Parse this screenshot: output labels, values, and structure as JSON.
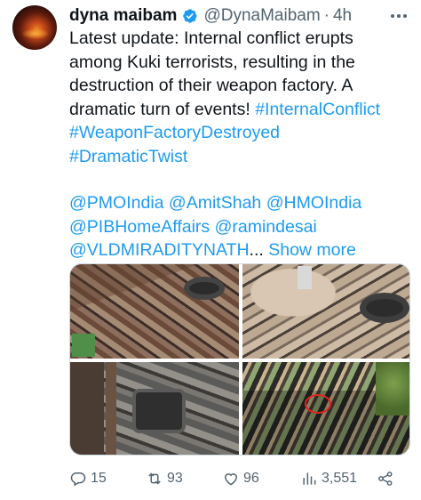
{
  "author": {
    "display_name": "dyna maibam",
    "handle": "@DynaMaibam",
    "separator": "·",
    "time": "4h",
    "verified_icon": "verified-badge-icon"
  },
  "tweet": {
    "lines": [
      "Latest update: Internal conflict erupts",
      "among Kuki terrorists, resulting in the",
      "destruction of their weapon factory. A"
    ],
    "line4_text": "dramatic turn of events! ",
    "hashtags": [
      "#InternalConflict",
      "#WeaponFactoryDestroyed",
      "#DramaticTwist"
    ],
    "mentions": [
      "@PMOIndia",
      "@AmitShah",
      "@HMOIndia",
      "@PIBHomeAffairs",
      "@ramindesai",
      "@VLDMIRADITYNATH"
    ],
    "ellipsis": "...",
    "show_more": "Show more"
  },
  "media": {
    "photo_count": 4
  },
  "actions": {
    "reply": {
      "icon": "reply-icon",
      "count": "15"
    },
    "retweet": {
      "icon": "retweet-icon",
      "count": "93"
    },
    "like": {
      "icon": "heart-icon",
      "count": "96"
    },
    "views": {
      "icon": "views-icon",
      "count": "3,551"
    },
    "share": {
      "icon": "share-icon"
    }
  },
  "colors": {
    "text": "#0f1419",
    "secondary": "#536471",
    "link": "#1d9bf0",
    "verified": "#1d9bf0"
  }
}
